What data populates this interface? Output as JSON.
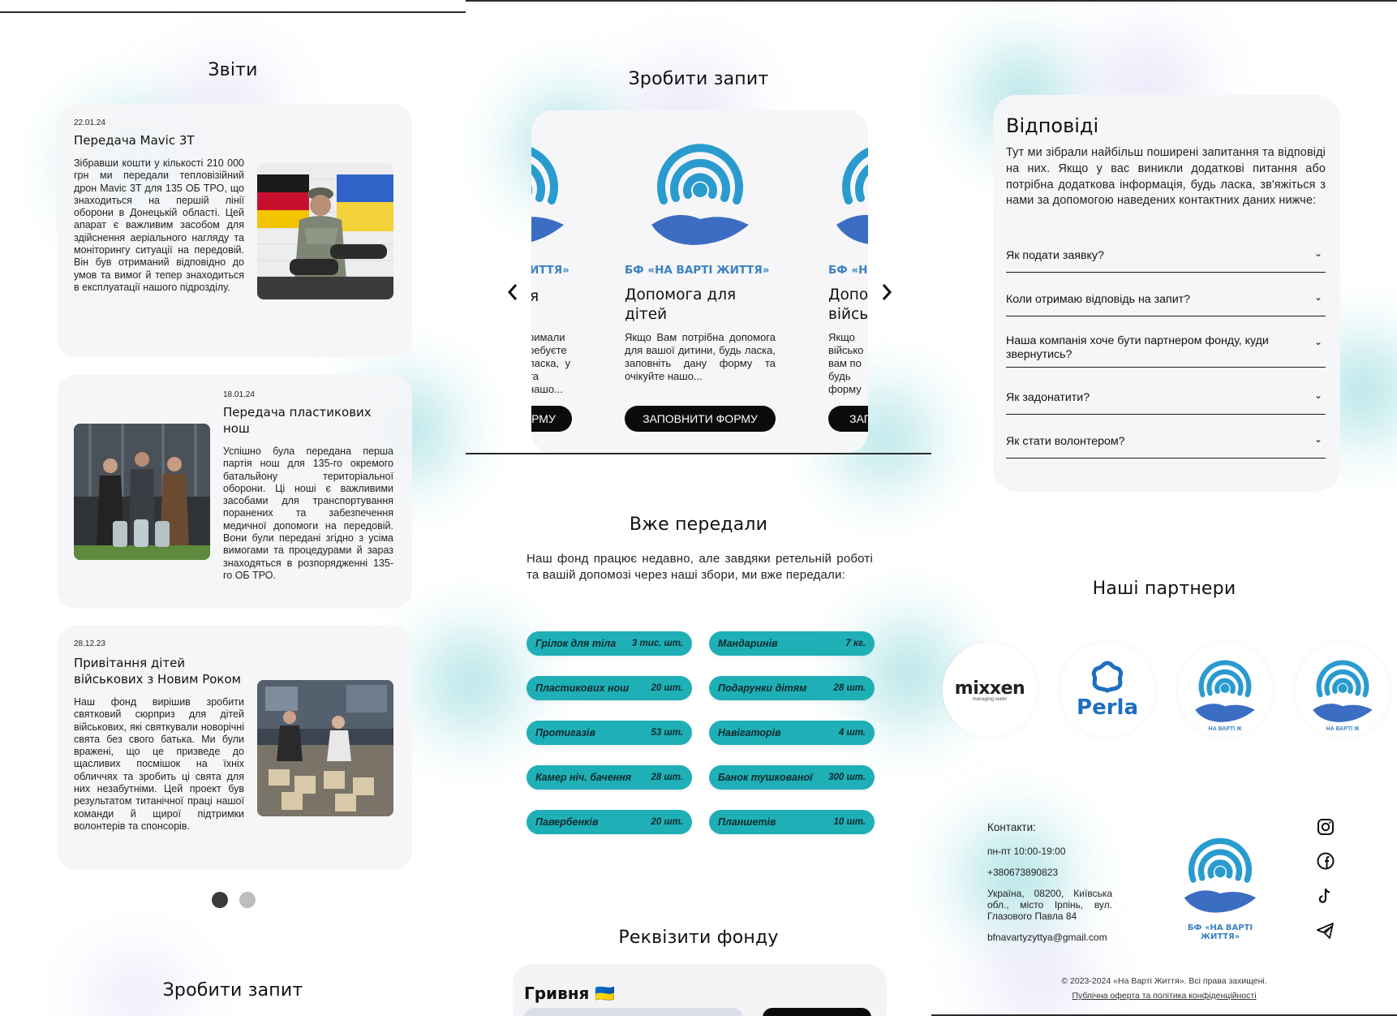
{
  "reports": {
    "title": "Звіти",
    "items": [
      {
        "date": "22.01.24",
        "title": "Передача Mavic 3T",
        "text": "Зібравши кошти у кількості 210 000 грн ми передали тепловізійний дрон Mavic 3T для 135 ОБ ТРО, що знаходиться на першій лінії оборони в Донецькій області. Цей апарат є важливим засобом для здійснення аеріального нагляду та моніторингу ситуації на передовій. Він був отриманий відповідно до умов та вимог й тепер знаходиться в експлуатації нашого підрозділу."
      },
      {
        "date": "18.01.24",
        "title": "Передача пластикових нош",
        "text": "Успішно була передана перша партія нош для 135-го окремого батальйону територіальної оборони. Ці ноші є важливими засобами для транспортування поранених та забезпечення медичної допомоги на передовій. Вони були передані згідно з усіма вимогами та процедурами й зараз знаходяться в розпорядженні 135-го ОБ ТРО."
      },
      {
        "date": "28.12.23",
        "title": "Привітання дітей військових з Новим Роком",
        "text": "Наш фонд вирішив зробити святковий сюрприз для дітей військових, які святкували новорічні свята без свого батька. Ми були вражені, що це призведе до щасливих посмішок на їхніх обличчях та зробить ці свята для них незабутніми. Цей проект був результатом титанічної праці нашої команди й щирої підтримки волонтерів та спонсорів."
      }
    ],
    "dots": [
      "active",
      "inactive"
    ]
  },
  "request_bottom": {
    "title": "Зробити запит"
  },
  "request": {
    "title": "Зробити запит",
    "fund_name": "БФ «НА ВАРТІ ЖИТТЯ»",
    "left_peek": {
      "fund_name": "ИТТЯ»",
      "title": "я",
      "text": "римали ребуєте ласка, у та нашо...",
      "button": "РМУ"
    },
    "main": {
      "title": "Допомога для дітей",
      "text": "Якщо Вам потрібна допомога для вашої дитини, будь ласка, заповніть дану форму та очікуйте нашо...",
      "button": "ЗАПОВНИТИ ФОРМУ"
    },
    "right_peek": {
      "fund_name": "БФ «Н",
      "title": "Допо війсь",
      "text": "Якщо військо вам по будь форму",
      "button": "ЗАП"
    },
    "prev": "‹",
    "next": "›"
  },
  "delivered": {
    "title": "Вже передали",
    "intro": "Наш фонд працює недавно, але завдяки ретельній роботі та вашій допомозі через наші збори, ми вже передали:",
    "items": [
      {
        "name": "Грілок для тіла",
        "value": "3 тис. шт."
      },
      {
        "name": "Мандаринів",
        "value": "7 кг."
      },
      {
        "name": "Пластикових нош",
        "value": "20 шт."
      },
      {
        "name": "Подарунки дітям",
        "value": "28 шт."
      },
      {
        "name": "Протигазів",
        "value": "53 шт."
      },
      {
        "name": "Навігаторів",
        "value": "4 шт."
      },
      {
        "name": "Камер ніч. бачення",
        "value": "28 шт."
      },
      {
        "name": "Банок тушкованої",
        "value": "300 шт."
      },
      {
        "name": "Павербенків",
        "value": "20 шт."
      },
      {
        "name": "Планшетів",
        "value": "10 шт."
      }
    ]
  },
  "requisites": {
    "title": "Реквізити фонду",
    "currency": "Гривня 🇺🇦"
  },
  "faq": {
    "title": "Відповіді",
    "intro": "Тут ми зібрали найбільш поширені запитання та відповіді на них. Якщо у вас виникли додаткові питання або потрібна додаткова інформація, будь ласка, зв'яжіться з нами за допомогою наведених контактних даних нижче:",
    "items": [
      "Як подати заявку?",
      "Коли отримаю відповідь на запит?",
      "Наша компанія хоче бути партнером фонду, куди звернутись?",
      "Як задонатити?",
      "Як стати волонтером?"
    ]
  },
  "partners": {
    "title": "Наші партнери",
    "mixxen": "mixxen",
    "mixxen_sub": "managing water",
    "perla": "Perla",
    "fund_short": "НА ВАРТІ Ж"
  },
  "contacts": {
    "label": "Контакти:",
    "hours": "пн-пт 10:00-19:00",
    "phone": "+380673890823",
    "address": "Україна, 08200, Київська обл., місто Ірпінь, вул. Глазового Павла 84",
    "email": "bfnavartyzyttya@gmail.com",
    "fund_name": "БФ «НА ВАРТІ ЖИТТЯ»"
  },
  "footer": {
    "copyright": "© 2023-2024 «На Варті Життя». Всі права захищені.",
    "offer_link": "Публічна оферта та політика конфіденційності"
  },
  "colors": {
    "teal": "#1fafb7",
    "brand_blue": "#3b82c4",
    "dark": "#0b0b0b",
    "card": "#f5f5f7"
  }
}
